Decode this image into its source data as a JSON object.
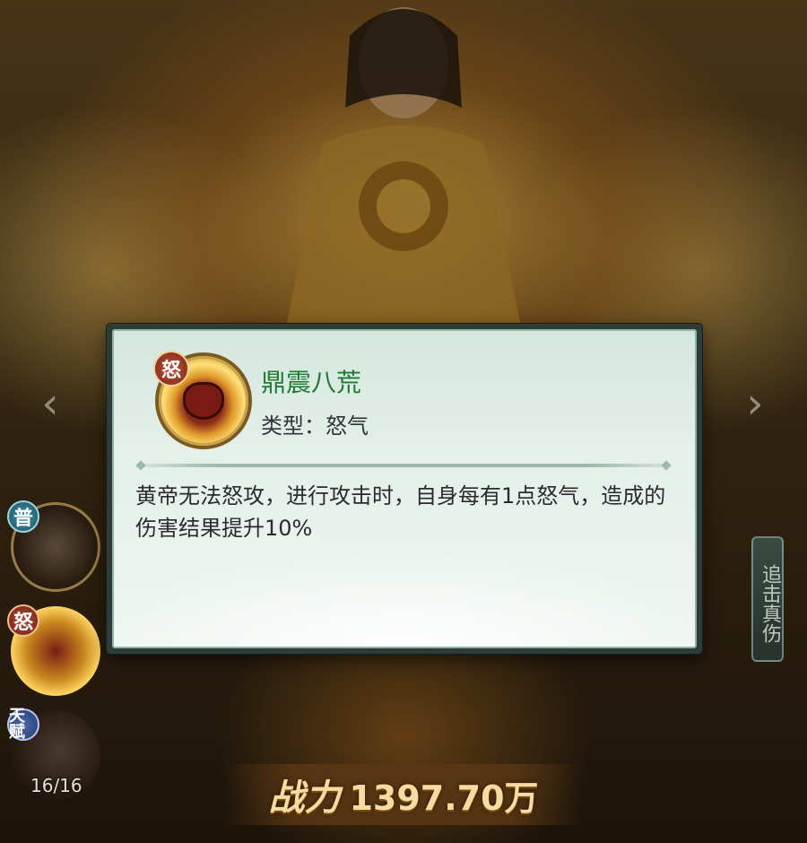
{
  "skill_popup": {
    "badge": "怒",
    "name": "鼎震八荒",
    "type_prefix": "类型：",
    "type_value": "怒气",
    "description": "黄帝无法怒攻，进行攻击时，自身每有1点怒气，造成的伤害结果提升10%"
  },
  "left_skills": {
    "badge_1": "普",
    "badge_2": "怒",
    "badge_3": "天赋",
    "talent_count": "16/16"
  },
  "right_label": "追击真伤",
  "power": {
    "label": "战力",
    "value": "1397.70万"
  },
  "icons": {
    "skill_icon": "cauldron-skill-icon",
    "nav_left": "arrow-left-icon",
    "nav_right": "arrow-right-icon"
  },
  "colors": {
    "skill_name": "#1f7a34",
    "dialog_border": "#2e3b36",
    "power_text": "#f6dca0"
  }
}
